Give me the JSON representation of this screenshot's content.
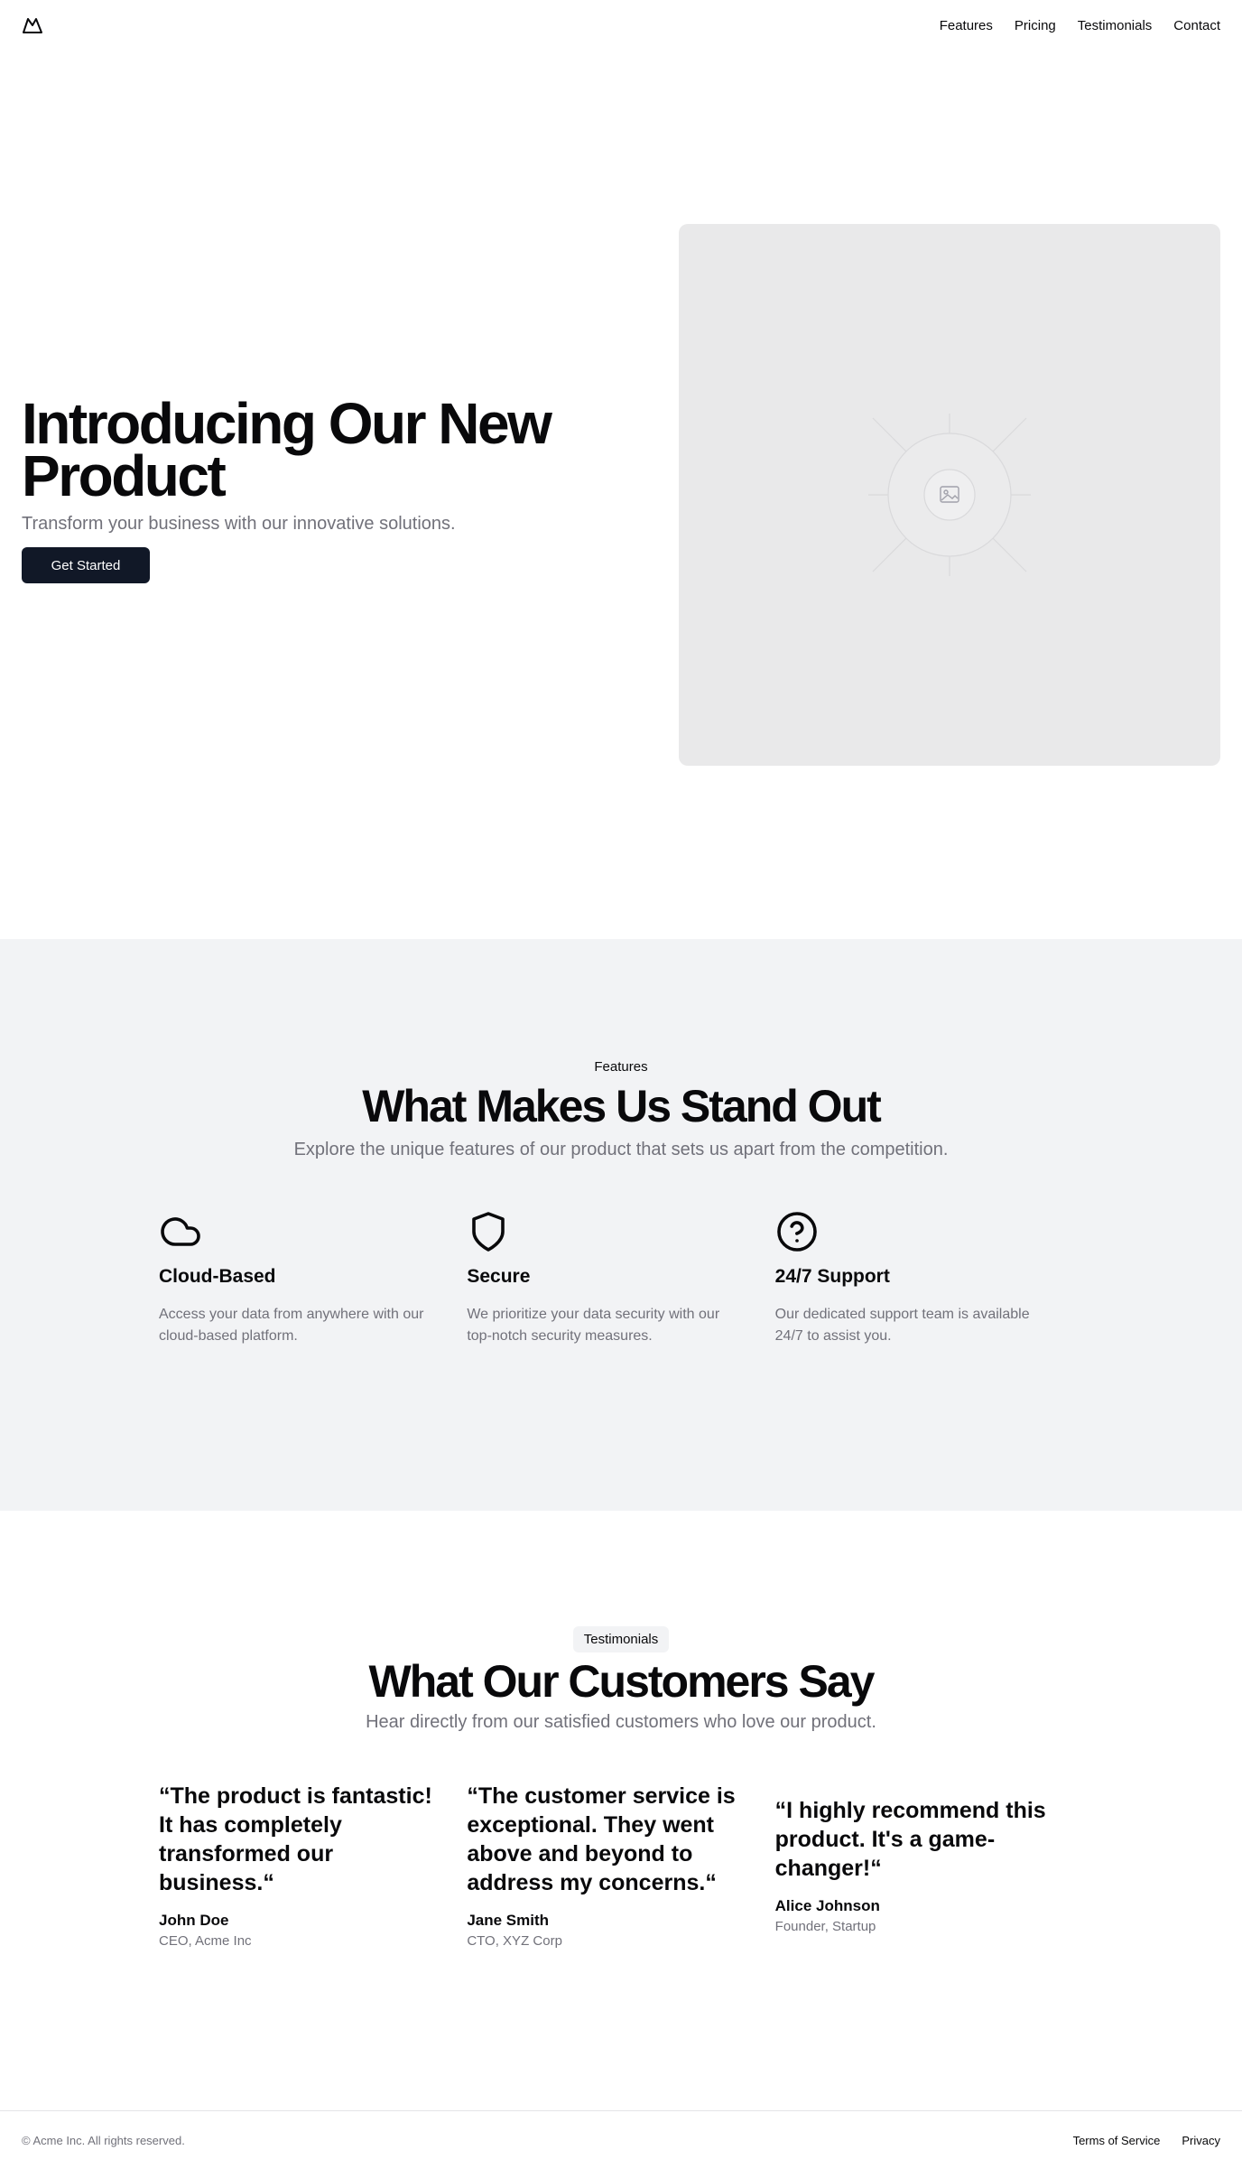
{
  "header": {
    "nav": [
      {
        "label": "Features"
      },
      {
        "label": "Pricing"
      },
      {
        "label": "Testimonials"
      },
      {
        "label": "Contact"
      }
    ]
  },
  "hero": {
    "title": "Introducing Our New Product",
    "subtitle": "Transform your business with our innovative solutions.",
    "cta_label": "Get Started",
    "image_icon": "image-placeholder-icon"
  },
  "features": {
    "kicker": "Features",
    "title": "What Makes Us Stand Out",
    "subtitle": "Explore the unique features of our product that sets us apart from the competition.",
    "items": [
      {
        "icon": "cloud-icon",
        "title": "Cloud-Based",
        "desc": "Access your data from anywhere with our cloud-based platform."
      },
      {
        "icon": "shield-icon",
        "title": "Secure",
        "desc": "We prioritize your data security with our top-notch security measures."
      },
      {
        "icon": "help-circle-icon",
        "title": "24/7 Support",
        "desc": "Our dedicated support team is available 24/7 to assist you."
      }
    ]
  },
  "testimonials": {
    "badge": "Testimonials",
    "title": "What Our Customers Say",
    "subtitle": "Hear directly from our satisfied customers who love our product.",
    "items": [
      {
        "quote": "“The product is fantastic! It has completely transformed our business.“",
        "author": "John Doe",
        "role": "CEO, Acme Inc"
      },
      {
        "quote": "“The customer service is exceptional. They went above and beyond to address my concerns.“",
        "author": "Jane Smith",
        "role": "CTO, XYZ Corp"
      },
      {
        "quote": "“I highly recommend this product. It's a game-changer!“",
        "author": "Alice Johnson",
        "role": "Founder, Startup"
      }
    ]
  },
  "footer": {
    "copyright": "© Acme Inc. All rights reserved.",
    "links": [
      {
        "label": "Terms of Service"
      },
      {
        "label": "Privacy"
      }
    ]
  },
  "colors": {
    "primary_button": "#111827",
    "features_bg": "#f2f3f5",
    "muted_text": "#71717a",
    "image_placeholder_bg": "#e9e9ea"
  }
}
